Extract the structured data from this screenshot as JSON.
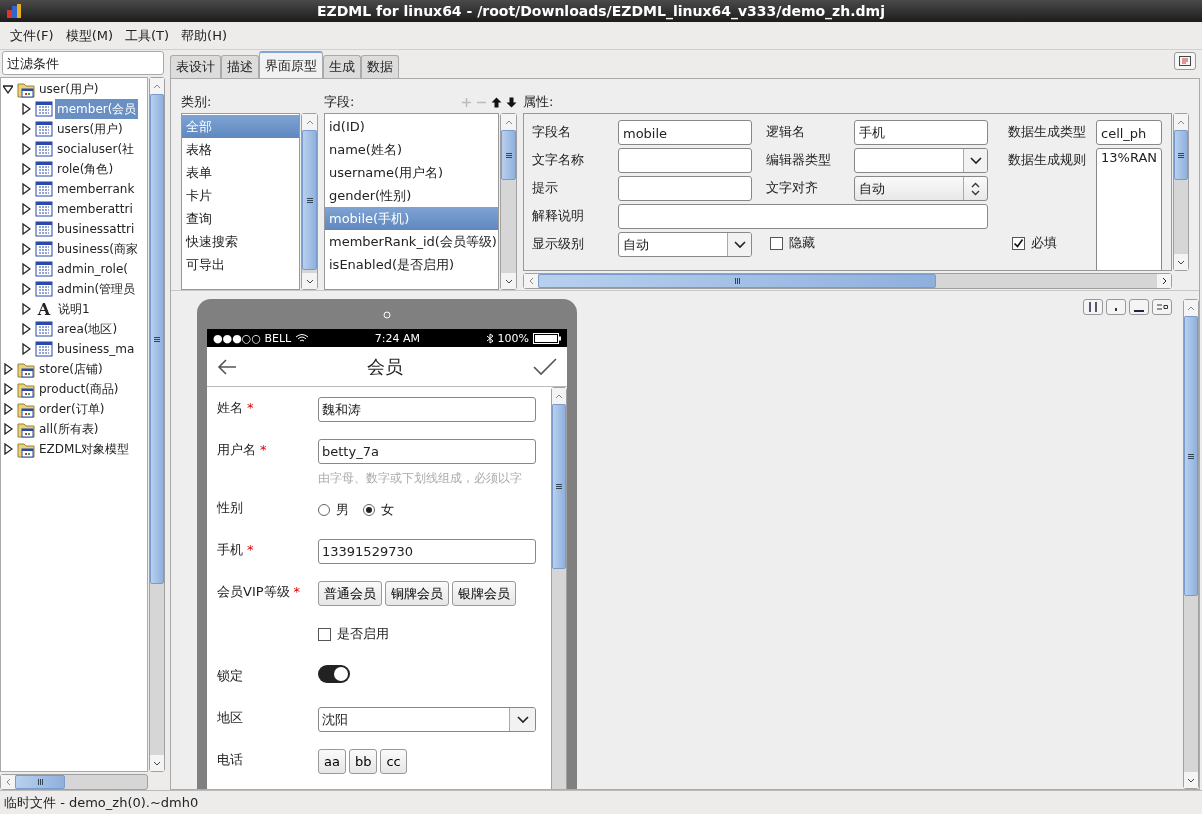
{
  "window": {
    "title": "EZDML for linux64 - /root/Downloads/EZDML_linux64_v333/demo_zh.dmj"
  },
  "menu": [
    "文件(F)",
    "模型(M)",
    "工具(T)",
    "帮助(H)"
  ],
  "filter": {
    "placeholder": "过滤条件"
  },
  "tree": [
    {
      "label": "user(用户)",
      "kind": "folder",
      "expanded": true,
      "selected": false,
      "children": [
        {
          "label": "member(会员",
          "kind": "table",
          "expanded": false,
          "selected": true
        },
        {
          "label": "users(用户)",
          "kind": "table",
          "expanded": false,
          "selected": false
        },
        {
          "label": "socialuser(社",
          "kind": "table",
          "expanded": false,
          "selected": false
        },
        {
          "label": "role(角色)",
          "kind": "table",
          "expanded": false,
          "selected": false
        },
        {
          "label": "memberrank",
          "kind": "table",
          "expanded": false,
          "selected": false
        },
        {
          "label": "memberattri",
          "kind": "table",
          "expanded": false,
          "selected": false
        },
        {
          "label": "businessattri",
          "kind": "table",
          "expanded": false,
          "selected": false
        },
        {
          "label": "business(商家",
          "kind": "table",
          "expanded": false,
          "selected": false
        },
        {
          "label": "admin_role(",
          "kind": "table",
          "expanded": false,
          "selected": false
        },
        {
          "label": "admin(管理员",
          "kind": "table",
          "expanded": false,
          "selected": false
        },
        {
          "label": "说明1",
          "kind": "text",
          "icon_char": "A",
          "expanded": false,
          "selected": false
        },
        {
          "label": "area(地区)",
          "kind": "table",
          "expanded": false,
          "selected": false
        },
        {
          "label": "business_ma",
          "kind": "table",
          "expanded": false,
          "selected": false
        }
      ]
    },
    {
      "label": "store(店铺)",
      "kind": "folder",
      "expanded": false,
      "selected": false
    },
    {
      "label": "product(商品)",
      "kind": "folder",
      "expanded": false,
      "selected": false
    },
    {
      "label": "order(订单)",
      "kind": "folder",
      "expanded": false,
      "selected": false
    },
    {
      "label": "all(所有表)",
      "kind": "folder",
      "expanded": false,
      "selected": false
    },
    {
      "label": "EZDML对象模型",
      "kind": "folder",
      "expanded": false,
      "selected": false
    }
  ],
  "tabs": [
    {
      "label": "表设计",
      "selected": false
    },
    {
      "label": "描述",
      "selected": false
    },
    {
      "label": "界面原型",
      "selected": true
    },
    {
      "label": "生成",
      "selected": false
    },
    {
      "label": "数据",
      "selected": false
    }
  ],
  "categories": {
    "title": "类别:",
    "items": [
      {
        "label": "全部",
        "selected": true
      },
      {
        "label": "表格",
        "selected": false
      },
      {
        "label": "表单",
        "selected": false
      },
      {
        "label": "卡片",
        "selected": false
      },
      {
        "label": "查询",
        "selected": false
      },
      {
        "label": "快速搜索",
        "selected": false
      },
      {
        "label": "可导出",
        "selected": false
      }
    ]
  },
  "fields": {
    "title": "字段:",
    "items": [
      {
        "label": "id(ID)",
        "selected": false
      },
      {
        "label": "name(姓名)",
        "selected": false
      },
      {
        "label": "username(用户名)",
        "selected": false
      },
      {
        "label": "gender(性别)",
        "selected": false
      },
      {
        "label": "mobile(手机)",
        "selected": true
      },
      {
        "label": "memberRank_id(会员等级)",
        "selected": false
      },
      {
        "label": "isEnabled(是否启用)",
        "selected": false
      }
    ]
  },
  "properties": {
    "title": "属性:",
    "rows": [
      [
        {
          "label": "字段名",
          "kind": "text",
          "value": "mobile"
        },
        {
          "label": "逻辑名",
          "kind": "text",
          "value": "手机"
        },
        {
          "label": "数据生成类型",
          "kind": "text",
          "value": "cell_ph"
        }
      ],
      [
        {
          "label": "文字名称",
          "kind": "text"
        },
        {
          "label": "编辑器类型",
          "kind": "select"
        },
        {
          "label": "数据生成规则",
          "kind": "memo",
          "value": "13%RAN"
        }
      ],
      [
        {
          "label": "提示",
          "kind": "text"
        },
        {
          "label": "文字对齐",
          "kind": "spin",
          "value": "自动"
        }
      ],
      [
        {
          "label": "解释说明",
          "kind": "wide"
        }
      ],
      [
        {
          "label": "显示级别",
          "kind": "select",
          "value": "自动"
        },
        {
          "label": "隐藏",
          "kind": "checkbox",
          "checked": false
        },
        {
          "label": "必填",
          "kind": "checkbox",
          "checked": true
        }
      ]
    ]
  },
  "phone": {
    "carrier": "●●●○○ BELL",
    "time": "7:24 AM",
    "battery": "100%",
    "title": "会员",
    "form": [
      {
        "kind": "text",
        "label": "姓名",
        "required_mark": "*",
        "value": "魏和涛"
      },
      {
        "kind": "text",
        "label": "用户名",
        "required_mark": "*",
        "value": "betty_7a",
        "hint": "由字母、数字或下划线组成，必须以字"
      },
      {
        "kind": "radio",
        "label": "性别",
        "options": [
          {
            "label": "男",
            "selected": false
          },
          {
            "label": "女",
            "selected": true
          }
        ]
      },
      {
        "kind": "text",
        "label": "手机",
        "required_mark": "*",
        "value": "13391529730"
      },
      {
        "kind": "buttons",
        "label": "会员VIP等级",
        "required_mark": "*",
        "options": [
          "普通会员",
          "铜牌会员",
          "银牌会员"
        ]
      },
      {
        "kind": "checkbox",
        "text": "是否启用",
        "checked": false
      },
      {
        "kind": "toggle",
        "label": "锁定",
        "on": true
      },
      {
        "kind": "select",
        "label": "地区",
        "value": "沈阳"
      },
      {
        "kind": "tags",
        "label": "电话",
        "options": [
          "aa",
          "bb",
          "cc"
        ]
      }
    ]
  },
  "status_bar": "临时文件 - demo_zh(0).~dmh0"
}
